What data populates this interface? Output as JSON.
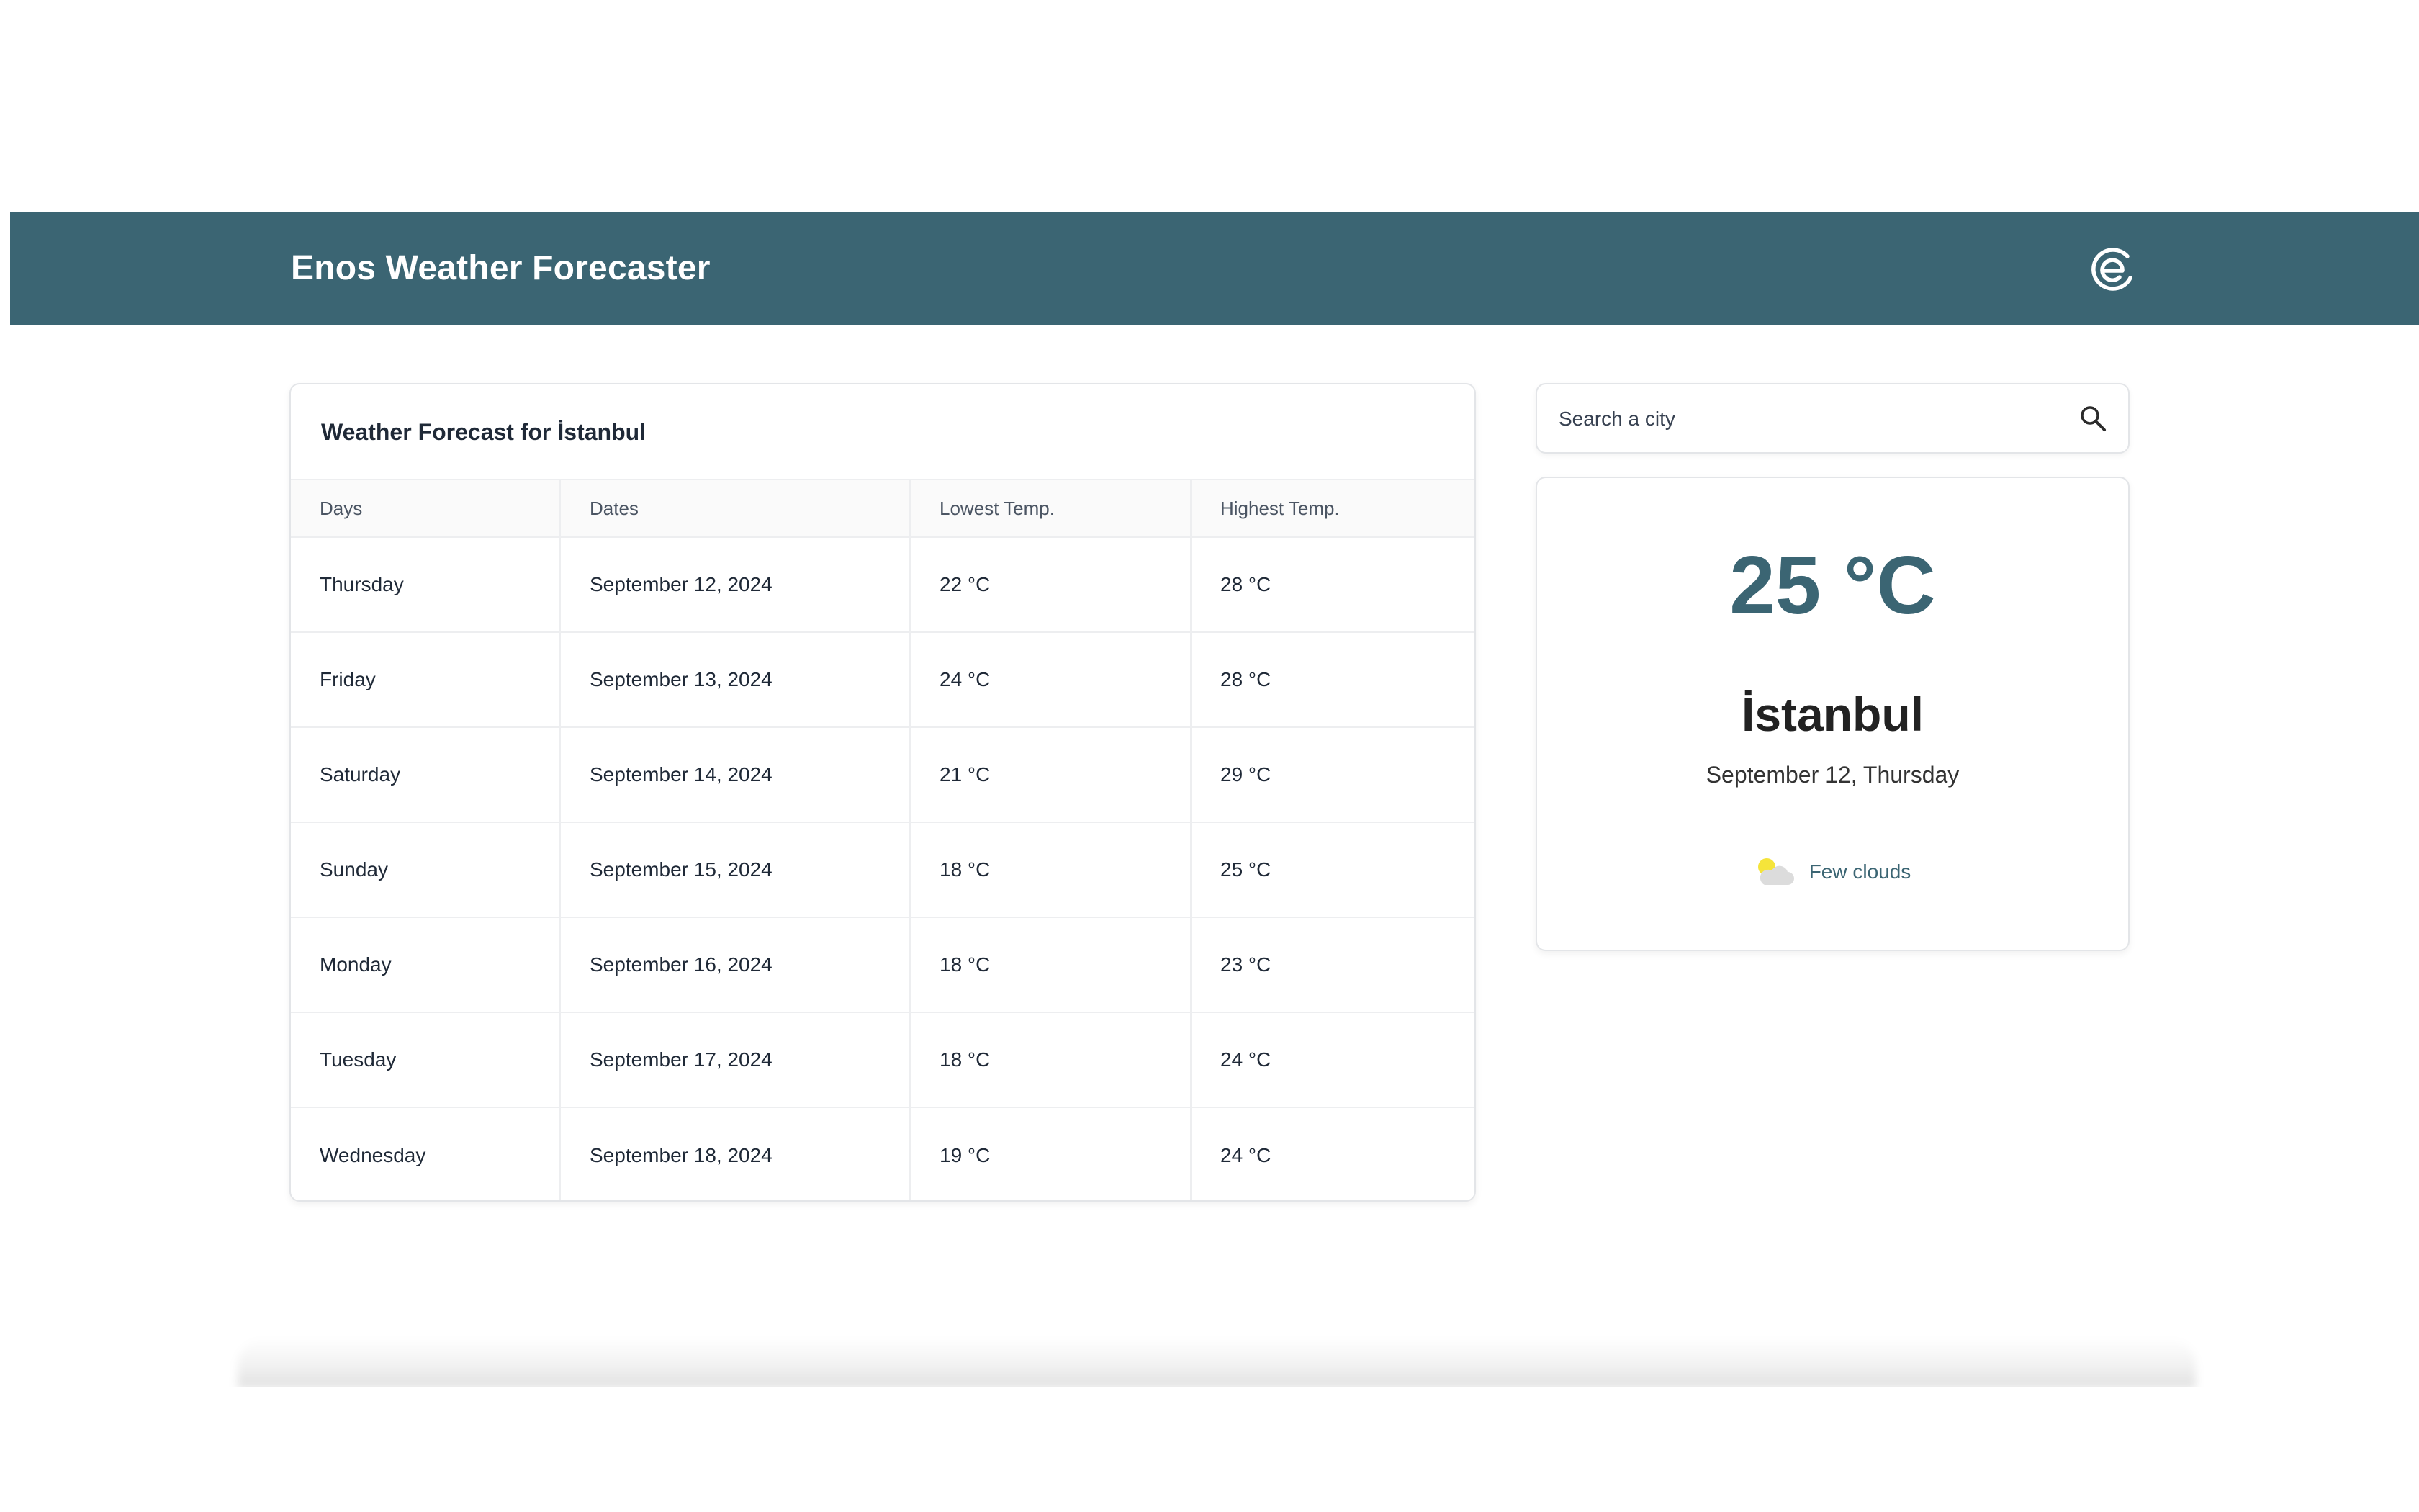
{
  "app": {
    "title": "Enos Weather Forecaster",
    "logo_icon": "enos-e-logo-icon",
    "brand_color": "#3b6573"
  },
  "forecast": {
    "title": "Weather Forecast for İstanbul",
    "columns": [
      "Days",
      "Dates",
      "Lowest Temp.",
      "Highest Temp."
    ],
    "rows": [
      {
        "day": "Thursday",
        "date": "September 12, 2024",
        "low": "22 °C",
        "high": "28 °C"
      },
      {
        "day": "Friday",
        "date": "September 13, 2024",
        "low": "24 °C",
        "high": "28 °C"
      },
      {
        "day": "Saturday",
        "date": "September 14, 2024",
        "low": "21 °C",
        "high": "29 °C"
      },
      {
        "day": "Sunday",
        "date": "September 15, 2024",
        "low": "18 °C",
        "high": "25 °C"
      },
      {
        "day": "Monday",
        "date": "September 16, 2024",
        "low": "18 °C",
        "high": "23 °C"
      },
      {
        "day": "Tuesday",
        "date": "September 17, 2024",
        "low": "18 °C",
        "high": "24 °C"
      },
      {
        "day": "Wednesday",
        "date": "September 18, 2024",
        "low": "19 °C",
        "high": "24 °C"
      }
    ]
  },
  "search": {
    "placeholder": "Search a city",
    "value": "",
    "icon": "search-icon"
  },
  "current": {
    "temperature": "25 °C",
    "city": "İstanbul",
    "date": "September 12, Thursday",
    "condition": "Few clouds",
    "condition_icon": "few-clouds-icon",
    "temperature_color": "#3b6573"
  }
}
